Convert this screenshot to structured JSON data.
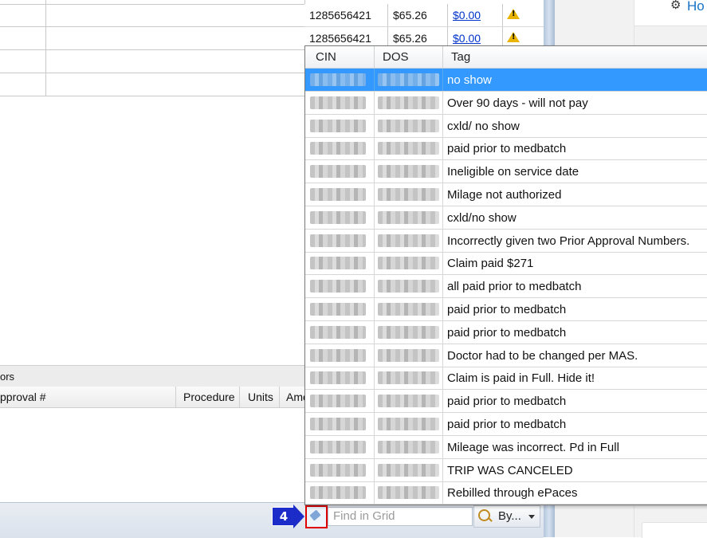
{
  "background_grid": {
    "top_rows": [
      {
        "cin": "1285656421",
        "amount": "$65.26",
        "paid": "$0.00"
      },
      {
        "cin": "1285656421",
        "amount": "$65.26",
        "paid": "$0.00"
      }
    ],
    "sub_header_text": "ors",
    "columns": {
      "approval": "pproval #",
      "procedure": "Procedure",
      "units": "Units",
      "amount": "Amo"
    }
  },
  "right_panel": {
    "card_label": "Ho",
    "icon": "gear-icon"
  },
  "popup": {
    "headers": {
      "cin": "CIN",
      "dos": "DOS",
      "tag": "Tag"
    },
    "rows": [
      {
        "tag": "no show",
        "selected": true
      },
      {
        "tag": "Over 90 days - will not pay"
      },
      {
        "tag": "cxld/ no show"
      },
      {
        "tag": "paid prior to medbatch"
      },
      {
        "tag": "Ineligible on service date"
      },
      {
        "tag": "Milage not authorized"
      },
      {
        "tag": "cxld/no show"
      },
      {
        "tag": "Incorrectly given two Prior Approval Numbers."
      },
      {
        "tag": "Claim paid $271"
      },
      {
        "tag": "all paid prior to medbatch"
      },
      {
        "tag": "paid prior to medbatch"
      },
      {
        "tag": "paid prior to medbatch"
      },
      {
        "tag": "Doctor had to be changed per MAS."
      },
      {
        "tag": "Claim is paid in Full. Hide it!"
      },
      {
        "tag": "paid prior to medbatch"
      },
      {
        "tag": "paid prior to medbatch"
      },
      {
        "tag": "Mileage was incorrect. Pd in Full"
      },
      {
        "tag": "TRIP WAS CANCELED"
      },
      {
        "tag": "Rebilled through ePaces"
      }
    ]
  },
  "statusbar": {
    "step_number": "4",
    "find_placeholder": "Find in Grid",
    "by_label": "By...",
    "tag_button_icon": "tag-icon",
    "search_icon": "magnifier-icon"
  },
  "colors": {
    "selection": "#3399ff",
    "link": "#0033cc",
    "step_badge": "#1c2cc8",
    "highlight_border": "#e00000",
    "warning": "#e8b400"
  }
}
